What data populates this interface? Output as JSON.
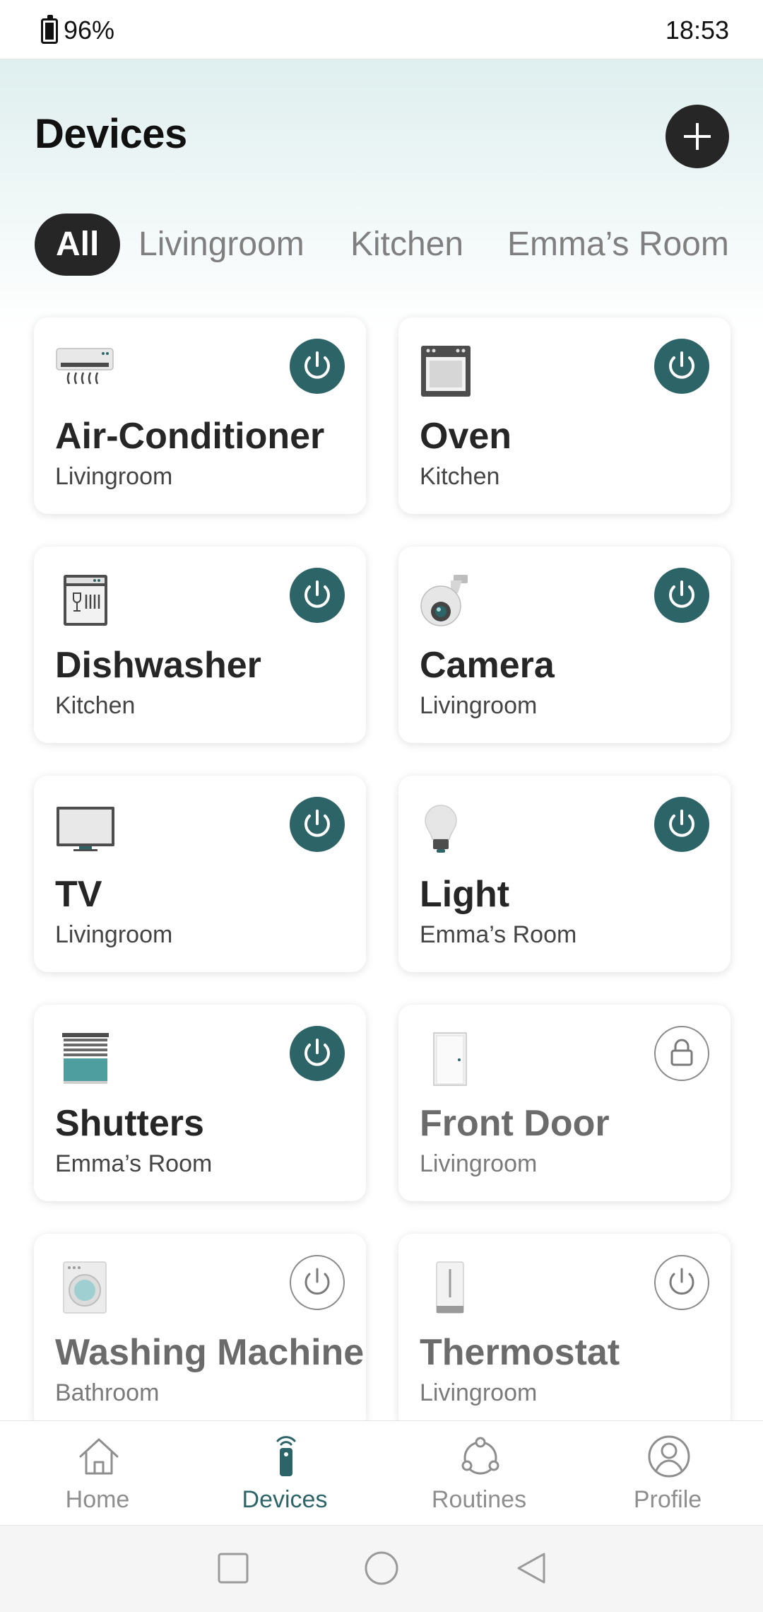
{
  "status_bar": {
    "battery": "96%",
    "time": "18:53"
  },
  "header": {
    "title": "Devices"
  },
  "tabs": [
    {
      "label": "All",
      "active": true
    },
    {
      "label": "Livingroom",
      "active": false
    },
    {
      "label": "Kitchen",
      "active": false
    },
    {
      "label": "Emma’s Room",
      "active": false
    }
  ],
  "devices": [
    {
      "name": "Air-Conditioner",
      "room": "Livingroom",
      "icon": "air-conditioner-icon",
      "control": "power",
      "on": true
    },
    {
      "name": "Oven",
      "room": "Kitchen",
      "icon": "oven-icon",
      "control": "power",
      "on": true
    },
    {
      "name": "Dishwasher",
      "room": "Kitchen",
      "icon": "dishwasher-icon",
      "control": "power",
      "on": true
    },
    {
      "name": "Camera",
      "room": "Livingroom",
      "icon": "camera-icon",
      "control": "power",
      "on": true
    },
    {
      "name": "TV",
      "room": "Livingroom",
      "icon": "tv-icon",
      "control": "power",
      "on": true
    },
    {
      "name": "Light",
      "room": "Emma’s Room",
      "icon": "light-bulb-icon",
      "control": "power",
      "on": true
    },
    {
      "name": "Shutters",
      "room": "Emma’s Room",
      "icon": "shutters-icon",
      "control": "power",
      "on": true
    },
    {
      "name": "Front Door",
      "room": "Livingroom",
      "icon": "door-icon",
      "control": "lock",
      "on": false
    },
    {
      "name": "Washing Machine",
      "room": "Bathroom",
      "icon": "washing-machine-icon",
      "control": "power",
      "on": false
    },
    {
      "name": "Thermostat",
      "room": "Livingroom",
      "icon": "thermostat-icon",
      "control": "power",
      "on": false
    }
  ],
  "bottom_nav": [
    {
      "label": "Home",
      "icon": "home-icon",
      "active": false
    },
    {
      "label": "Devices",
      "icon": "remote-icon",
      "active": true
    },
    {
      "label": "Routines",
      "icon": "routines-icon",
      "active": false
    },
    {
      "label": "Profile",
      "icon": "profile-icon",
      "active": false
    }
  ],
  "colors": {
    "accent": "#2d6468",
    "dark": "#262626",
    "muted": "#8e8e8e"
  }
}
